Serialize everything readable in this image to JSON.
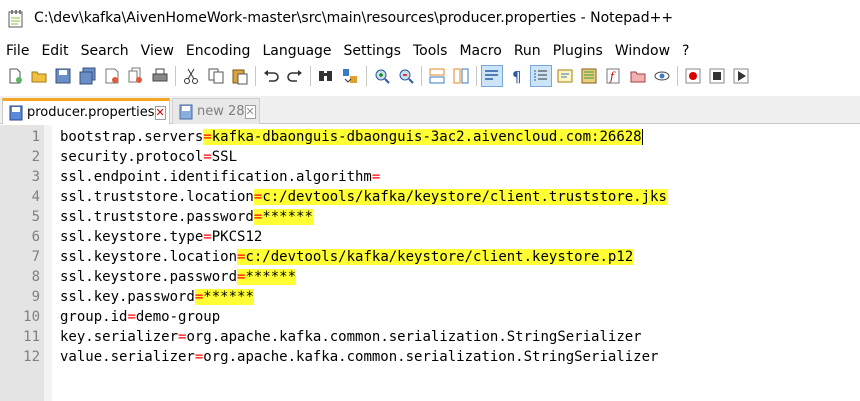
{
  "window": {
    "title": "C:\\dev\\kafka\\AivenHomeWork-master\\src\\main\\resources\\producer.properties - Notepad++"
  },
  "menu": [
    "File",
    "Edit",
    "Search",
    "View",
    "Encoding",
    "Language",
    "Settings",
    "Tools",
    "Macro",
    "Run",
    "Plugins",
    "Window",
    "?"
  ],
  "toolbar": {
    "icons": [
      "new-file-icon",
      "open-file-icon",
      "save-icon",
      "save-all-icon",
      "close-icon",
      "close-all-icon",
      "print-icon",
      "cut-icon",
      "copy-icon",
      "paste-icon",
      "undo-icon",
      "redo-icon",
      "find-icon",
      "replace-icon",
      "zoom-in-icon",
      "zoom-out-icon",
      "sync-vertical-icon",
      "sync-horizontal-icon",
      "word-wrap-icon",
      "show-all-chars-icon",
      "indent-guide-icon",
      "udl-icon",
      "doc-map-icon",
      "function-list-icon",
      "folder-workspace-icon",
      "monitoring-icon",
      "record-macro-icon",
      "stop-record-icon",
      "play-macro-icon"
    ]
  },
  "tabs": [
    {
      "label": "producer.properties",
      "active": true
    },
    {
      "label": "new 28",
      "active": false
    }
  ],
  "editor": {
    "lines": [
      {
        "num": "1",
        "key": "bootstrap.servers",
        "eq": "=",
        "value": "kafka-dbaonguis-dbaonguis-3ac2.aivencloud.com:26628",
        "highlight": true
      },
      {
        "num": "2",
        "key": "security.protocol",
        "eq": "=",
        "value": "SSL",
        "highlight": false
      },
      {
        "num": "3",
        "key": "ssl.endpoint.identification.algorithm",
        "eq": "=",
        "value": "",
        "highlight": false
      },
      {
        "num": "4",
        "key": "ssl.truststore.location",
        "eq": "=",
        "value": "c:/devtools/kafka/keystore/client.truststore.jks",
        "highlight": true
      },
      {
        "num": "5",
        "key": "ssl.truststore.password",
        "eq": "=",
        "value": "******",
        "highlight": true
      },
      {
        "num": "6",
        "key": "ssl.keystore.type",
        "eq": "=",
        "value": "PKCS12",
        "highlight": false
      },
      {
        "num": "7",
        "key": "ssl.keystore.location",
        "eq": "=",
        "value": "c:/devtools/kafka/keystore/client.keystore.p12",
        "highlight": true
      },
      {
        "num": "8",
        "key": "ssl.keystore.password",
        "eq": "=",
        "value": "******",
        "highlight": true
      },
      {
        "num": "9",
        "key": "ssl.key.password",
        "eq": "=",
        "value": "******",
        "highlight": true
      },
      {
        "num": "10",
        "key": "group.id",
        "eq": "=",
        "value": "demo-group",
        "highlight": false
      },
      {
        "num": "11",
        "key": "key.serializer",
        "eq": "=",
        "value": "org.apache.kafka.common.serialization.StringSerializer",
        "highlight": false
      },
      {
        "num": "12",
        "key": "value.serializer",
        "eq": "=",
        "value": "org.apache.kafka.common.serialization.StringSerializer",
        "highlight": false
      }
    ]
  },
  "colors": {
    "equals": "#ff0000",
    "highlight": "#ffff33",
    "gutter": "#e4e4e4",
    "active_tab_accent": "#f5a623"
  }
}
